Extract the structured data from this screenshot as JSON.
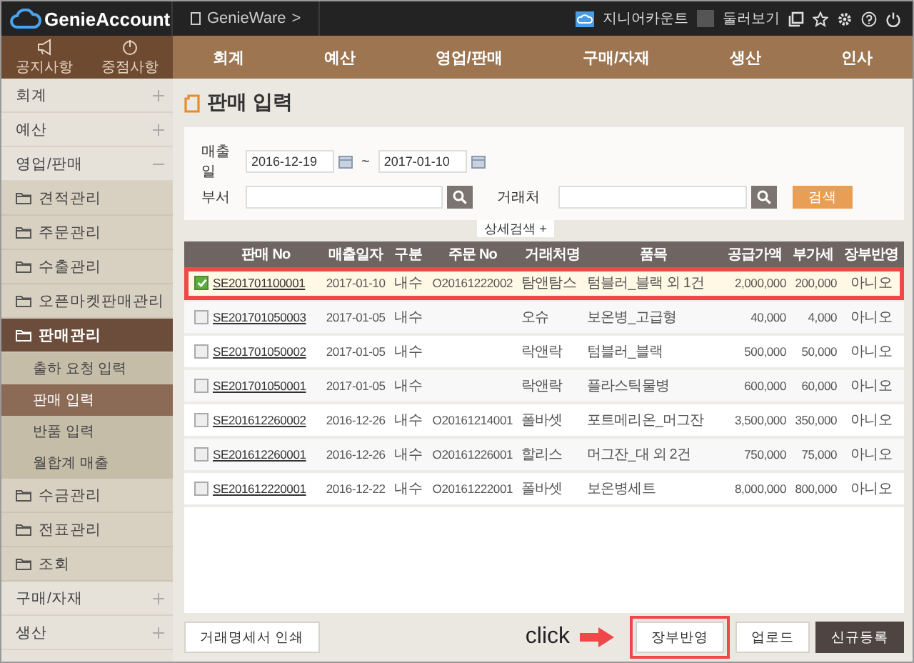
{
  "header": {
    "logo": "GenieAccount",
    "workspace": "GenieWare",
    "workspace_arrow": ">",
    "account_label": "지니어카운트",
    "tour_label": "둘러보기"
  },
  "quick_links": [
    {
      "label": "공지사항",
      "kind": "megaphone"
    },
    {
      "label": "중점사항",
      "kind": "power"
    }
  ],
  "top_menu": [
    {
      "label": "회계",
      "selected": false
    },
    {
      "label": "예산",
      "selected": false
    },
    {
      "label": "영업/판매",
      "selected": false
    },
    {
      "label": "구매/자재",
      "selected": false
    },
    {
      "label": "생산",
      "selected": false
    },
    {
      "label": "인사",
      "selected": false
    }
  ],
  "sidebar": {
    "items": [
      {
        "label": "회계",
        "expanded": false
      },
      {
        "label": "예산",
        "expanded": false
      },
      {
        "label": "영업/판매",
        "expanded": true,
        "children": [
          {
            "label": "견적관리",
            "selected": false
          },
          {
            "label": "주문관리",
            "selected": false
          },
          {
            "label": "수출관리",
            "selected": false
          },
          {
            "label": "오픈마켓판매관리",
            "selected": false
          },
          {
            "label": "판매관리",
            "selected": true,
            "children": [
              {
                "label": "출하 요청 입력",
                "selected": false
              },
              {
                "label": "판매 입력",
                "selected": true
              },
              {
                "label": "반품 입력",
                "selected": false
              },
              {
                "label": "월합계 매출",
                "selected": false
              }
            ]
          },
          {
            "label": "수금관리",
            "selected": false
          },
          {
            "label": "전표관리",
            "selected": false
          },
          {
            "label": "조회",
            "selected": false
          }
        ]
      },
      {
        "label": "구매/자재",
        "expanded": false
      },
      {
        "label": "생산",
        "expanded": false
      }
    ]
  },
  "page_title": "판매 입력",
  "search": {
    "date_label": "매출일",
    "date_from": "2016-12-19",
    "date_sep": "~",
    "date_to": "2017-01-10",
    "dept_label": "부서",
    "client_label": "거래처",
    "search_button": "검색",
    "detail_toggle": "상세검색 +"
  },
  "table": {
    "columns": [
      "판매 No",
      "매출일자",
      "구분",
      "주문 No",
      "거래처명",
      "품목",
      "공급가액",
      "부가세",
      "장부반영"
    ],
    "rows": [
      {
        "checked": true,
        "highlighted": true,
        "cells": [
          "SE201701100001",
          "2017-01-10",
          "내수",
          "O20161222002",
          "탐앤탐스",
          "텀블러_블랙 외 1건",
          "2,000,000",
          "200,000",
          "아니오"
        ]
      },
      {
        "checked": false,
        "highlighted": false,
        "cells": [
          "SE201701050003",
          "2017-01-05",
          "내수",
          "",
          "오슈",
          "보온병_고급형",
          "40,000",
          "4,000",
          "아니오"
        ]
      },
      {
        "checked": false,
        "highlighted": false,
        "cells": [
          "SE201701050002",
          "2017-01-05",
          "내수",
          "",
          "락앤락",
          "텀블러_블랙",
          "500,000",
          "50,000",
          "아니오"
        ]
      },
      {
        "checked": false,
        "highlighted": false,
        "cells": [
          "SE201701050001",
          "2017-01-05",
          "내수",
          "",
          "락앤락",
          "플라스틱물병",
          "600,000",
          "60,000",
          "아니오"
        ]
      },
      {
        "checked": false,
        "highlighted": false,
        "cells": [
          "SE201612260002",
          "2016-12-26",
          "내수",
          "O20161214001",
          "폴바셋",
          "포트메리온_머그잔",
          "3,500,000",
          "350,000",
          "아니오"
        ]
      },
      {
        "checked": false,
        "highlighted": false,
        "cells": [
          "SE201612260001",
          "2016-12-26",
          "내수",
          "O20161226001",
          "할리스",
          "머그잔_대 외 2건",
          "750,000",
          "75,000",
          "아니오"
        ]
      },
      {
        "checked": false,
        "highlighted": false,
        "cells": [
          "SE201612220001",
          "2016-12-22",
          "내수",
          "O20161222001",
          "폴바셋",
          "보온병세트",
          "8,000,000",
          "800,000",
          "아니오"
        ]
      }
    ]
  },
  "footer": {
    "print_button": "거래명세서 인쇄",
    "click_label": "click",
    "buttons": [
      {
        "label": "장부반영",
        "kind": "plain",
        "highlighted": true
      },
      {
        "label": "업로드",
        "kind": "plain",
        "highlighted": false
      },
      {
        "label": "신규등록",
        "kind": "dark",
        "highlighted": false
      }
    ]
  }
}
